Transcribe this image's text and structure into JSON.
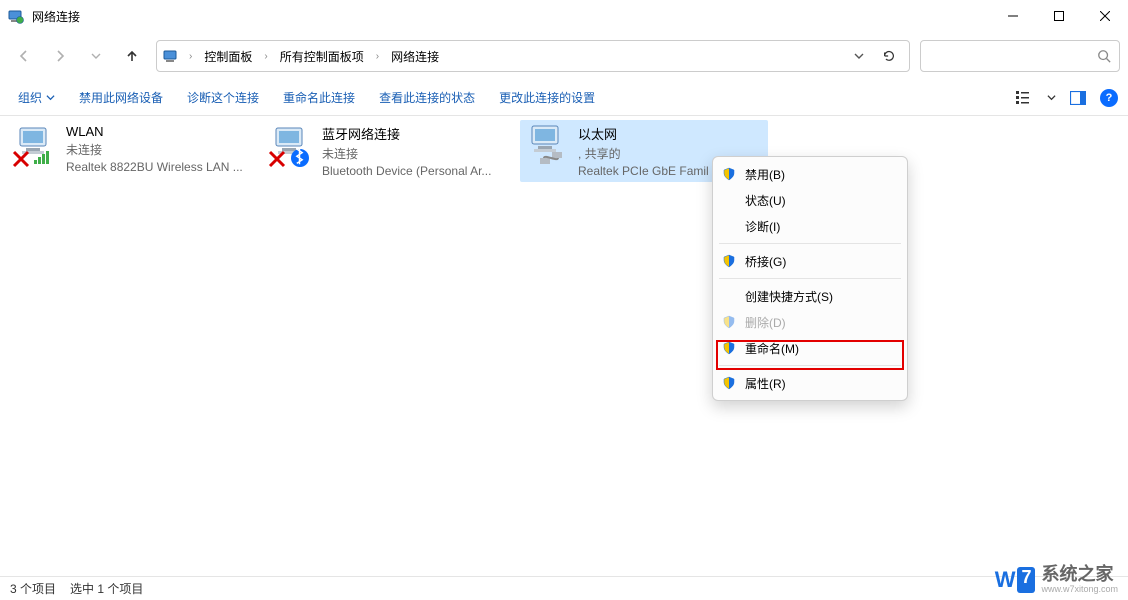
{
  "window": {
    "title": "网络连接"
  },
  "breadcrumb": {
    "root": "控制面板",
    "all": "所有控制面板项",
    "current": "网络连接"
  },
  "toolbar": {
    "organize": "组织",
    "disable": "禁用此网络设备",
    "diagnose": "诊断这个连接",
    "rename": "重命名此连接",
    "viewstatus": "查看此连接的状态",
    "changeset": "更改此连接的设置"
  },
  "adapters": [
    {
      "name": "WLAN",
      "status": "未连接",
      "device": "Realtek 8822BU Wireless LAN ..."
    },
    {
      "name": "蓝牙网络连接",
      "status": "未连接",
      "device": "Bluetooth Device (Personal Ar..."
    },
    {
      "name": "以太网",
      "status": ", 共享的",
      "device": "Realtek PCIe GbE Famil"
    }
  ],
  "contextmenu": {
    "disable": "禁用(B)",
    "status": "状态(U)",
    "diag": "诊断(I)",
    "bridge": "桥接(G)",
    "shortcut": "创建快捷方式(S)",
    "delete": "删除(D)",
    "rename": "重命名(M)",
    "props": "属性(R)"
  },
  "statusbar": {
    "count": "3 个项目",
    "selected": "选中 1 个项目"
  },
  "watermark": {
    "brand_a": "W",
    "brand_b": "7",
    "text": "系统之家",
    "url": "www.w7xitong.com"
  }
}
